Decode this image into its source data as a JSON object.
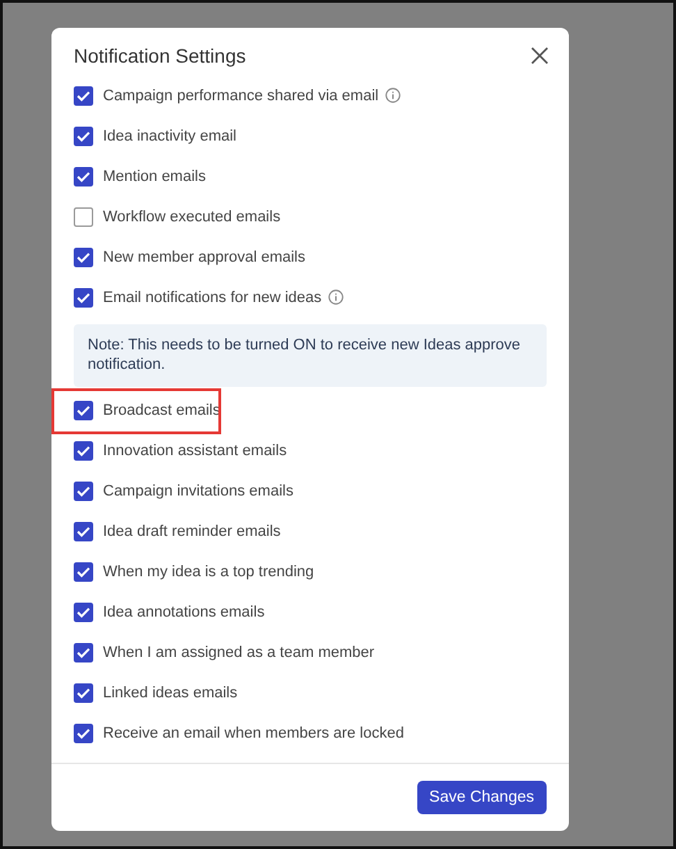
{
  "dialog": {
    "title": "Notification Settings",
    "items": [
      {
        "label": "Campaign performance shared via email",
        "checked": true,
        "info": true,
        "highlighted": false
      },
      {
        "label": "Idea inactivity email",
        "checked": true,
        "info": false,
        "highlighted": false
      },
      {
        "label": "Mention emails",
        "checked": true,
        "info": false,
        "highlighted": false
      },
      {
        "label": "Workflow executed emails",
        "checked": false,
        "info": false,
        "highlighted": false
      },
      {
        "label": "New member approval emails",
        "checked": true,
        "info": false,
        "highlighted": false
      },
      {
        "label": "Email notifications for new ideas",
        "checked": true,
        "info": true,
        "highlighted": false,
        "note": "Note: This needs to be turned ON to receive new Ideas approve notification."
      },
      {
        "label": "Broadcast emails",
        "checked": true,
        "info": false,
        "highlighted": true
      },
      {
        "label": "Innovation assistant emails",
        "checked": true,
        "info": false,
        "highlighted": false
      },
      {
        "label": "Campaign invitations emails",
        "checked": true,
        "info": false,
        "highlighted": false
      },
      {
        "label": "Idea draft reminder emails",
        "checked": true,
        "info": false,
        "highlighted": false
      },
      {
        "label": "When my idea is a top trending",
        "checked": true,
        "info": false,
        "highlighted": false
      },
      {
        "label": "Idea annotations emails",
        "checked": true,
        "info": false,
        "highlighted": false
      },
      {
        "label": "When I am assigned as a team member",
        "checked": true,
        "info": false,
        "highlighted": false
      },
      {
        "label": "Linked ideas emails",
        "checked": true,
        "info": false,
        "highlighted": false
      },
      {
        "label": "Receive an email when members are locked",
        "checked": true,
        "info": false,
        "highlighted": false
      }
    ],
    "save_button": "Save Changes"
  }
}
